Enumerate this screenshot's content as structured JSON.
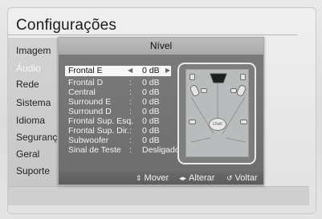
{
  "screen": {
    "title": "Configurações"
  },
  "menu": {
    "items": [
      {
        "label": "Imagem",
        "dim": false
      },
      {
        "label": "Áudio",
        "dim": true
      },
      {
        "label": "Rede",
        "dim": false
      },
      {
        "label": "Sistema",
        "dim": false
      },
      {
        "label": "Idioma",
        "dim": false
      },
      {
        "label": "Segurança",
        "dim": false
      },
      {
        "label": "Geral",
        "dim": false
      },
      {
        "label": "Suporte",
        "dim": false
      }
    ]
  },
  "dialog": {
    "title": "Nível",
    "rows": [
      {
        "label": "Frontal E",
        "value": "0 dB",
        "selected": true
      },
      {
        "label": "Frontal D",
        "value": "0 dB"
      },
      {
        "label": "Central",
        "value": "0 dB"
      },
      {
        "label": "Surround E",
        "value": "0 dB"
      },
      {
        "label": "Surround D",
        "value": "0 dB"
      },
      {
        "label": "Frontal Sup. Esq.",
        "value": "0 dB"
      },
      {
        "label": "Frontal Sup. Dir.",
        "value": "0 dB"
      },
      {
        "label": "Subwoofer",
        "value": "0 dB"
      },
      {
        "label": "Sinal de Teste",
        "value": "Desligado"
      }
    ],
    "separator": ":",
    "speaker_diagram": {
      "user_label": "User"
    },
    "footer": {
      "move": "Mover",
      "change": "Alterar",
      "back": "Voltar",
      "move_icon": "⇕",
      "change_icon": "◂▸",
      "back_icon": "↺"
    }
  },
  "colors": {
    "dialog_body": "#747474",
    "header": "#b3b3b3",
    "selection": "#f7f7f7"
  }
}
